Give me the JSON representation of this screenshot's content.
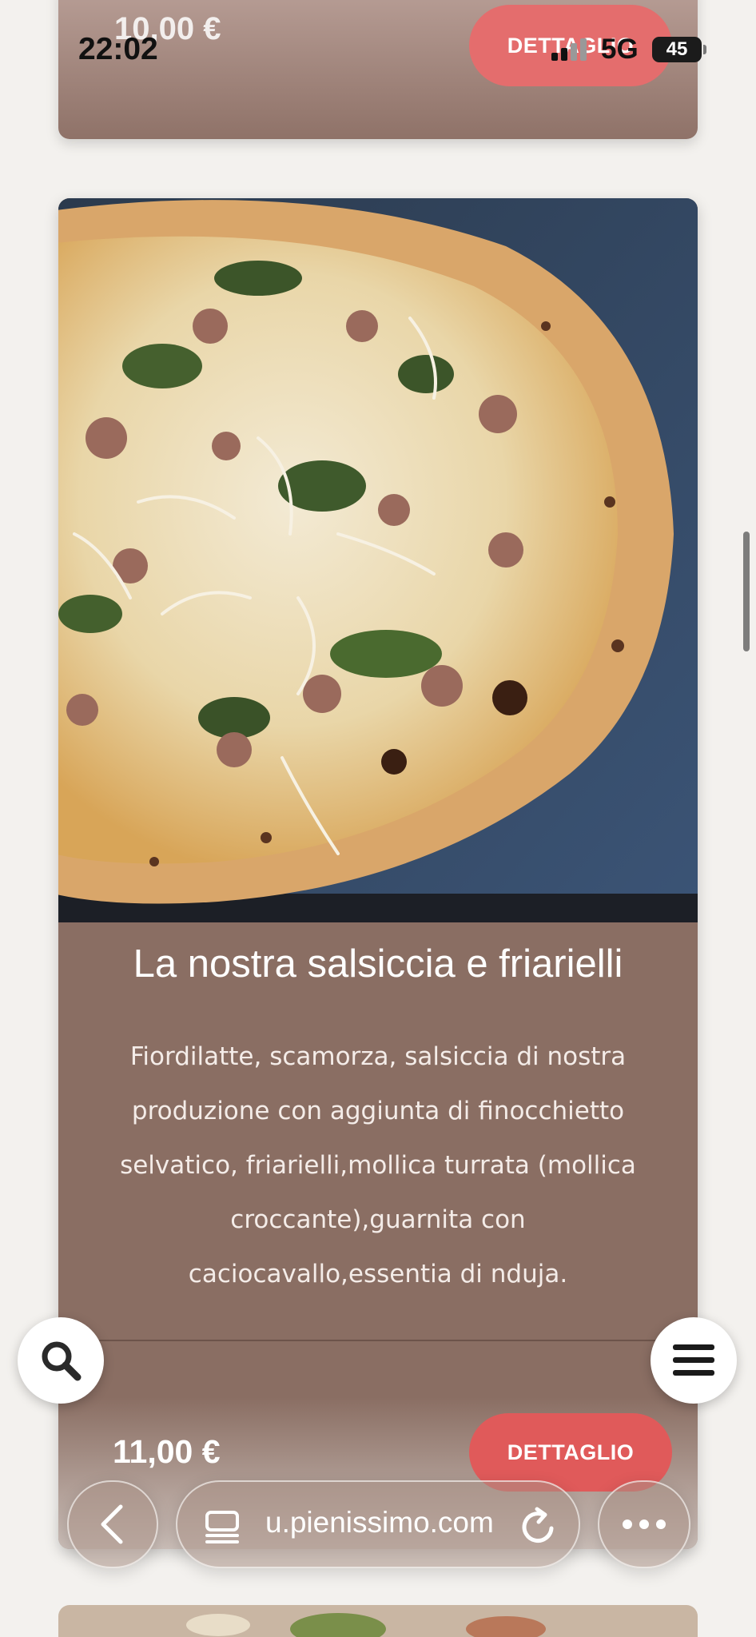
{
  "status_bar": {
    "time": "22:02",
    "network": "5G",
    "battery": "45"
  },
  "previous_card": {
    "price": "10,00 €",
    "detail_button": "DETTAGLIO"
  },
  "pizza_card": {
    "title": "La nostra salsiccia e friarielli",
    "description": "Fiordilatte, scamorza, salsiccia di nostra produzione con aggiunta di finocchietto selvatico, friarielli,mollica turrata (mollica croccante),guarnita con caciocavallo,essentia di nduja.",
    "price": "11,00 €",
    "detail_button": "DETTAGLIO"
  },
  "browser": {
    "url": "u.pienissimo.com"
  },
  "icons": {
    "search": "search-icon",
    "menu": "hamburger-menu-icon",
    "back": "chevron-left-icon",
    "tabs": "tabs-icon",
    "reload": "reload-icon",
    "more": "more-dots-icon"
  },
  "colors": {
    "card_background": "#8a6e63",
    "button": "#e05a5a",
    "page_background": "#f3f1ee"
  }
}
